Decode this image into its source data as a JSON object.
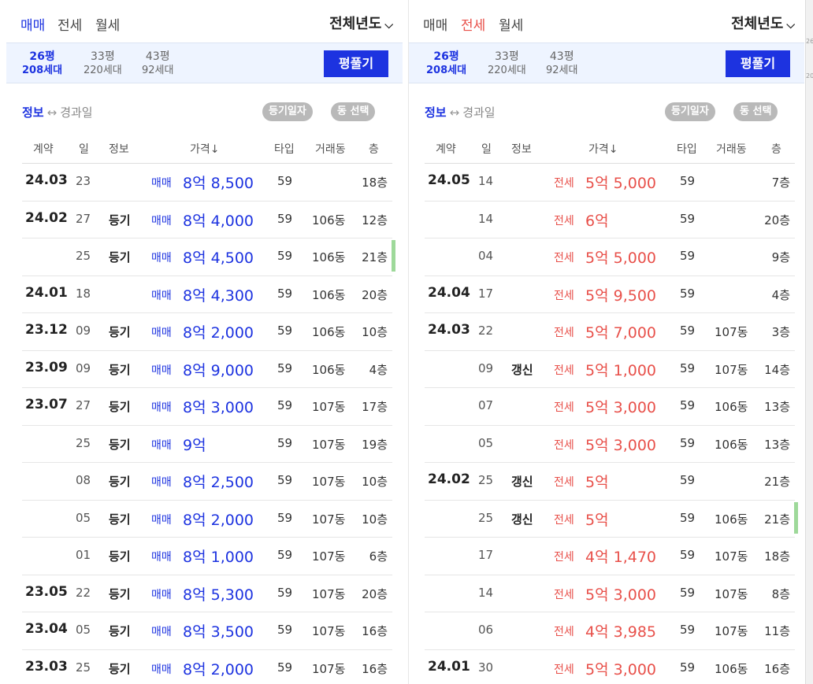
{
  "left": {
    "tabs": [
      {
        "label": "매매",
        "active": true
      },
      {
        "label": "전세",
        "active": false
      },
      {
        "label": "월세",
        "active": false
      }
    ],
    "year_select": "전체년도",
    "sizes": [
      {
        "pyeong": "26평",
        "households": "208세대",
        "active": true
      },
      {
        "pyeong": "33평",
        "households": "220세대",
        "active": false
      },
      {
        "pyeong": "43평",
        "households": "92세대",
        "active": false
      }
    ],
    "pyeong_button": "평풀기",
    "info_toggle": {
      "on": "정보",
      "arrow": "↔",
      "off": "경과일"
    },
    "pills": [
      "등기일자",
      "동 선택"
    ],
    "headers": {
      "date": "계약",
      "day": "일",
      "info": "정보",
      "price": "가격↓",
      "size": "타입",
      "dong": "거래동",
      "floor": "층"
    },
    "rows": [
      {
        "date": "24.03",
        "day": "23",
        "info": "",
        "type": "매매",
        "price": "8억 8,500",
        "size": "59",
        "dong": "",
        "floor": "18층"
      },
      {
        "date": "24.02",
        "day": "27",
        "info": "등기",
        "type": "매매",
        "price": "8억 4,000",
        "size": "59",
        "dong": "106동",
        "floor": "12층"
      },
      {
        "date": "",
        "day": "25",
        "info": "등기",
        "type": "매매",
        "price": "8억 4,500",
        "size": "59",
        "dong": "106동",
        "floor": "21층",
        "mark": true
      },
      {
        "date": "24.01",
        "day": "18",
        "info": "",
        "type": "매매",
        "price": "8억 4,300",
        "size": "59",
        "dong": "106동",
        "floor": "20층"
      },
      {
        "date": "23.12",
        "day": "09",
        "info": "등기",
        "type": "매매",
        "price": "8억 2,000",
        "size": "59",
        "dong": "106동",
        "floor": "10층"
      },
      {
        "date": "23.09",
        "day": "09",
        "info": "등기",
        "type": "매매",
        "price": "8억 9,000",
        "size": "59",
        "dong": "106동",
        "floor": "4층"
      },
      {
        "date": "23.07",
        "day": "27",
        "info": "등기",
        "type": "매매",
        "price": "8억 3,000",
        "size": "59",
        "dong": "107동",
        "floor": "17층"
      },
      {
        "date": "",
        "day": "25",
        "info": "등기",
        "type": "매매",
        "price": "9억",
        "size": "59",
        "dong": "107동",
        "floor": "19층"
      },
      {
        "date": "",
        "day": "08",
        "info": "등기",
        "type": "매매",
        "price": "8억 2,500",
        "size": "59",
        "dong": "107동",
        "floor": "10층"
      },
      {
        "date": "",
        "day": "05",
        "info": "등기",
        "type": "매매",
        "price": "8억 2,000",
        "size": "59",
        "dong": "107동",
        "floor": "10층"
      },
      {
        "date": "",
        "day": "01",
        "info": "등기",
        "type": "매매",
        "price": "8억 1,000",
        "size": "59",
        "dong": "107동",
        "floor": "6층"
      },
      {
        "date": "23.05",
        "day": "22",
        "info": "등기",
        "type": "매매",
        "price": "8억 5,300",
        "size": "59",
        "dong": "107동",
        "floor": "20층"
      },
      {
        "date": "23.04",
        "day": "05",
        "info": "등기",
        "type": "매매",
        "price": "8억 3,500",
        "size": "59",
        "dong": "107동",
        "floor": "16층"
      },
      {
        "date": "23.03",
        "day": "25",
        "info": "등기",
        "type": "매매",
        "price": "8억 2,000",
        "size": "59",
        "dong": "107동",
        "floor": "16층"
      }
    ]
  },
  "right": {
    "tabs": [
      {
        "label": "매매",
        "active": false
      },
      {
        "label": "전세",
        "active": true
      },
      {
        "label": "월세",
        "active": false
      }
    ],
    "year_select": "전체년도",
    "sizes": [
      {
        "pyeong": "26평",
        "households": "208세대",
        "active": true
      },
      {
        "pyeong": "33평",
        "households": "220세대",
        "active": false
      },
      {
        "pyeong": "43평",
        "households": "92세대",
        "active": false
      }
    ],
    "pyeong_button": "평풀기",
    "info_toggle": {
      "on": "정보",
      "arrow": "↔",
      "off": "경과일"
    },
    "pills": [
      "등기일자",
      "동 선택"
    ],
    "headers": {
      "date": "계약",
      "day": "일",
      "info": "정보",
      "price": "가격↓",
      "size": "타입",
      "dong": "거래동",
      "floor": "층"
    },
    "rows": [
      {
        "date": "24.05",
        "day": "14",
        "info": "",
        "type": "전세",
        "price": "5억 5,000",
        "size": "59",
        "dong": "",
        "floor": "7층"
      },
      {
        "date": "",
        "day": "14",
        "info": "",
        "type": "전세",
        "price": "6억",
        "size": "59",
        "dong": "",
        "floor": "20층"
      },
      {
        "date": "",
        "day": "04",
        "info": "",
        "type": "전세",
        "price": "5억 5,000",
        "size": "59",
        "dong": "",
        "floor": "9층"
      },
      {
        "date": "24.04",
        "day": "17",
        "info": "",
        "type": "전세",
        "price": "5억 9,500",
        "size": "59",
        "dong": "",
        "floor": "4층"
      },
      {
        "date": "24.03",
        "day": "22",
        "info": "",
        "type": "전세",
        "price": "5억 7,000",
        "size": "59",
        "dong": "107동",
        "floor": "3층"
      },
      {
        "date": "",
        "day": "09",
        "info": "갱신",
        "type": "전세",
        "price": "5억 1,000",
        "size": "59",
        "dong": "107동",
        "floor": "14층"
      },
      {
        "date": "",
        "day": "07",
        "info": "",
        "type": "전세",
        "price": "5억 3,000",
        "size": "59",
        "dong": "106동",
        "floor": "13층"
      },
      {
        "date": "",
        "day": "05",
        "info": "",
        "type": "전세",
        "price": "5억 3,000",
        "size": "59",
        "dong": "106동",
        "floor": "13층"
      },
      {
        "date": "24.02",
        "day": "25",
        "info": "갱신",
        "type": "전세",
        "price": "5억",
        "size": "59",
        "dong": "",
        "floor": "21층"
      },
      {
        "date": "",
        "day": "25",
        "info": "갱신",
        "type": "전세",
        "price": "5억",
        "size": "59",
        "dong": "106동",
        "floor": "21층",
        "mark": true
      },
      {
        "date": "",
        "day": "17",
        "info": "",
        "type": "전세",
        "price": "4억 1,470",
        "size": "59",
        "dong": "107동",
        "floor": "18층"
      },
      {
        "date": "",
        "day": "14",
        "info": "",
        "type": "전세",
        "price": "5억 3,000",
        "size": "59",
        "dong": "107동",
        "floor": "8층"
      },
      {
        "date": "",
        "day": "06",
        "info": "",
        "type": "전세",
        "price": "4억 3,985",
        "size": "59",
        "dong": "107동",
        "floor": "11층"
      },
      {
        "date": "24.01",
        "day": "30",
        "info": "",
        "type": "전세",
        "price": "5억 3,000",
        "size": "59",
        "dong": "106동",
        "floor": "16층"
      }
    ]
  },
  "edge_marks": [
    "26",
    "20"
  ],
  "colors": {
    "sale": "#1d33e0",
    "jeonse": "#e8504a",
    "pill": "#b9b9b9"
  }
}
